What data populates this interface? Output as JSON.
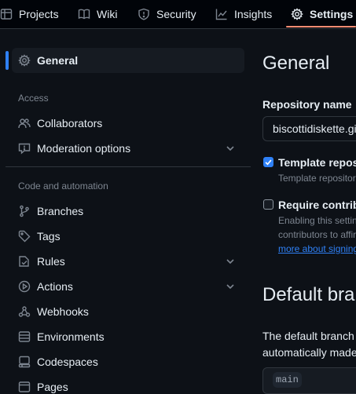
{
  "topnav": {
    "tabs": [
      {
        "label": "Projects",
        "icon": "table-icon"
      },
      {
        "label": "Wiki",
        "icon": "book-icon"
      },
      {
        "label": "Security",
        "icon": "shield-icon"
      },
      {
        "label": "Insights",
        "icon": "graph-icon"
      },
      {
        "label": "Settings",
        "icon": "gear-icon",
        "active": true
      }
    ],
    "accent": "#fd8c73"
  },
  "sidebar": {
    "general": {
      "label": "General",
      "icon": "gear-icon"
    },
    "access_heading": "Access",
    "access_items": [
      {
        "label": "Collaborators",
        "icon": "people-icon"
      },
      {
        "label": "Moderation options",
        "icon": "report-icon",
        "expandable": true
      }
    ],
    "code_heading": "Code and automation",
    "code_items": [
      {
        "label": "Branches",
        "icon": "branch-icon"
      },
      {
        "label": "Tags",
        "icon": "tag-icon"
      },
      {
        "label": "Rules",
        "icon": "rules-icon",
        "expandable": true
      },
      {
        "label": "Actions",
        "icon": "play-icon",
        "expandable": true
      },
      {
        "label": "Webhooks",
        "icon": "webhook-icon"
      },
      {
        "label": "Environments",
        "icon": "server-icon"
      },
      {
        "label": "Codespaces",
        "icon": "codespaces-icon"
      },
      {
        "label": "Pages",
        "icon": "browser-icon"
      }
    ],
    "active_color": "#2f81f7"
  },
  "main": {
    "title": "General",
    "repo_name_label": "Repository name",
    "repo_name_value": "biscottidiskette.github.io",
    "template": {
      "label": "Template repository",
      "note": "Template repositories let users generate new repositories",
      "checked": true
    },
    "signoff": {
      "label": "Require contributors to sign off on web-based commits",
      "note_line1": "Enabling this setting will require",
      "note_line2": "contributors to affirm that they have",
      "link": "more about signing off on commits",
      "checked": false
    },
    "default_branch_title": "Default branch",
    "default_branch_line1": "The default branch is considered the",
    "default_branch_line2": "automatically made against this",
    "default_branch_value": "main"
  }
}
